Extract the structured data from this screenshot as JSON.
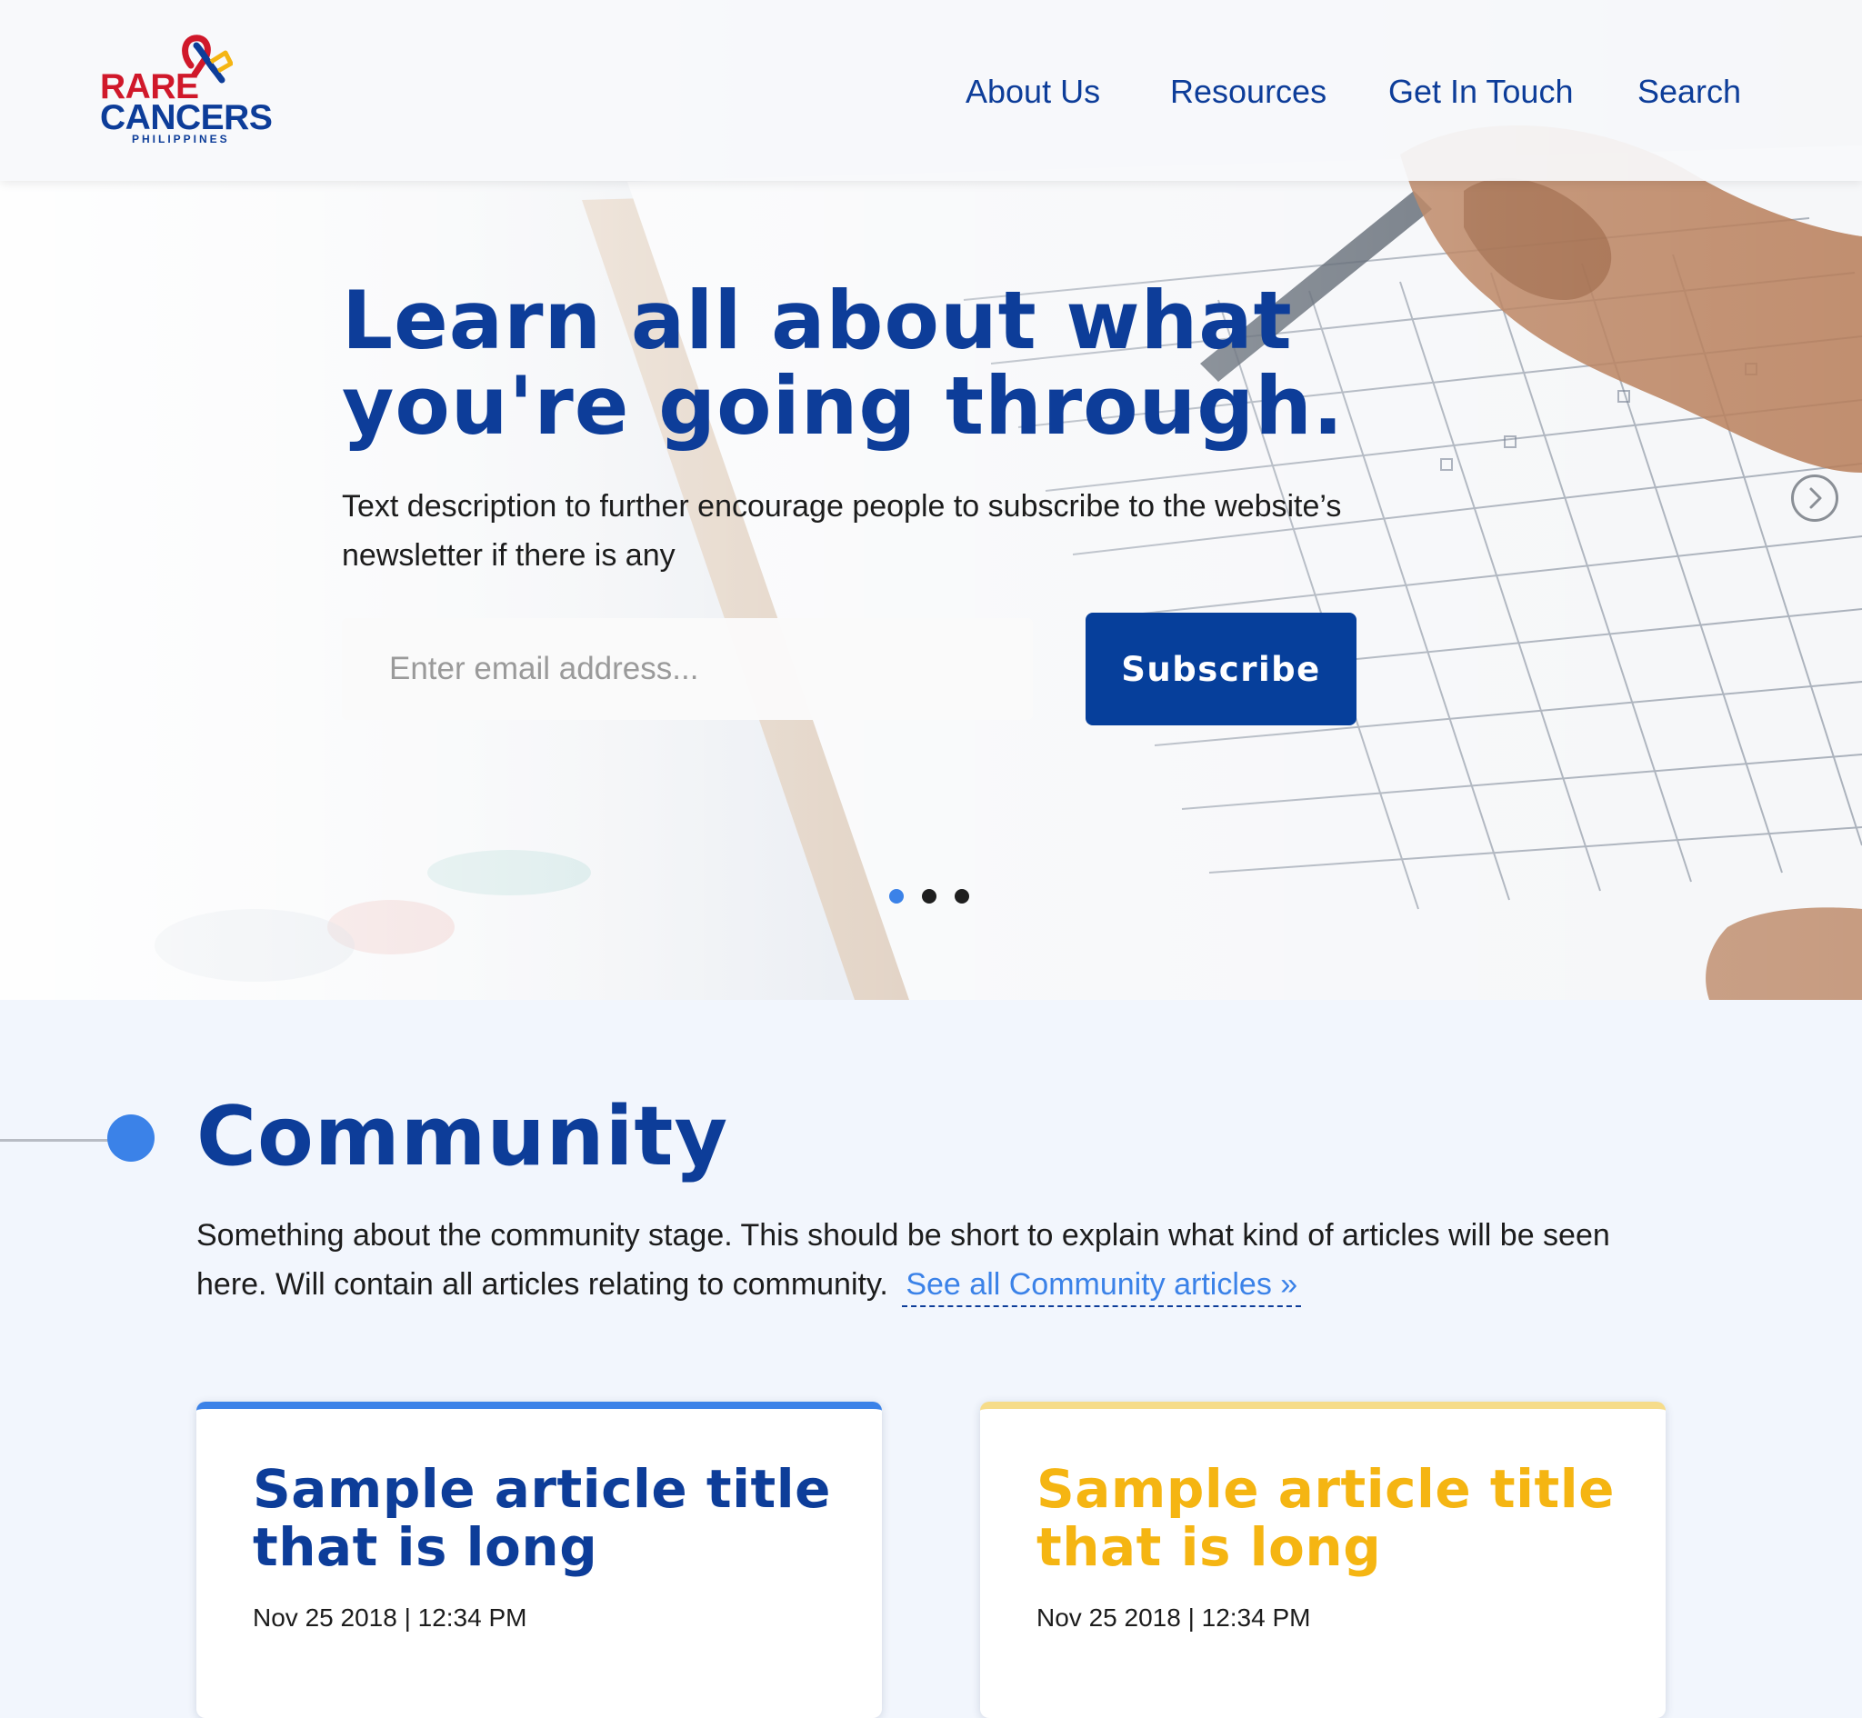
{
  "site": {
    "logo_line1": "RARE",
    "logo_line2": "CANCERS",
    "logo_line3": "PHILIPPINES"
  },
  "nav": {
    "items": [
      {
        "label": "About Us"
      },
      {
        "label": "Resources"
      },
      {
        "label": "Get In Touch"
      },
      {
        "label": "Search"
      }
    ]
  },
  "hero": {
    "title": "Learn all about what you're going through.",
    "description": "Text description to further encourage people to subscribe to the website’s newsletter if there is any",
    "email_placeholder": "Enter email address...",
    "subscribe_label": "Subscribe",
    "slides_total": 3,
    "active_slide": 1
  },
  "community": {
    "title": "Community",
    "description": "Something about the community stage. This should be short to explain what kind of articles will be seen here. Will contain all articles relating to community.",
    "see_all": "See all Community articles »",
    "cards": [
      {
        "title": "Sample article title that is long",
        "date": "Nov 25 2018 | 12:34 PM",
        "accent": "#3b82e8"
      },
      {
        "title": "Sample article title that is long",
        "date": "Nov 25 2018 | 12:34 PM",
        "accent": "#f5b512"
      }
    ]
  },
  "colors": {
    "brand_blue": "#0d3d99",
    "brand_red": "#d0182a",
    "accent_blue": "#3b82e8",
    "accent_yellow": "#f5b512",
    "button_blue": "#063f9b"
  }
}
